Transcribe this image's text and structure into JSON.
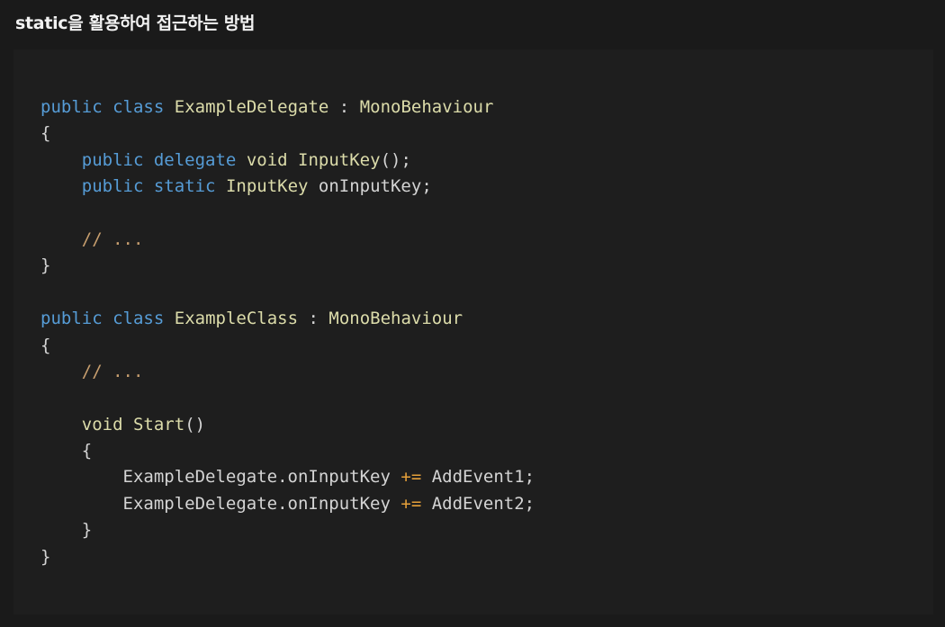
{
  "page": {
    "title": "static을 활용하여 접근하는 방법"
  },
  "code": {
    "lines": [
      [
        {
          "t": "keyword",
          "v": "public"
        },
        {
          "t": "plain",
          "v": " "
        },
        {
          "t": "keyword",
          "v": "class"
        },
        {
          "t": "plain",
          "v": " "
        },
        {
          "t": "type",
          "v": "ExampleDelegate"
        },
        {
          "t": "plain",
          "v": " "
        },
        {
          "t": "punct",
          "v": ":"
        },
        {
          "t": "plain",
          "v": " "
        },
        {
          "t": "type",
          "v": "MonoBehaviour"
        }
      ],
      [
        {
          "t": "punct",
          "v": "{"
        }
      ],
      [
        {
          "t": "plain",
          "v": "    "
        },
        {
          "t": "keyword",
          "v": "public"
        },
        {
          "t": "plain",
          "v": " "
        },
        {
          "t": "keyword",
          "v": "delegate"
        },
        {
          "t": "plain",
          "v": " "
        },
        {
          "t": "type",
          "v": "void"
        },
        {
          "t": "plain",
          "v": " "
        },
        {
          "t": "type",
          "v": "InputKey"
        },
        {
          "t": "paren",
          "v": "()"
        },
        {
          "t": "punct",
          "v": ";"
        }
      ],
      [
        {
          "t": "plain",
          "v": "    "
        },
        {
          "t": "keyword",
          "v": "public"
        },
        {
          "t": "plain",
          "v": " "
        },
        {
          "t": "keyword",
          "v": "static"
        },
        {
          "t": "plain",
          "v": " "
        },
        {
          "t": "type",
          "v": "InputKey"
        },
        {
          "t": "plain",
          "v": " "
        },
        {
          "t": "plain",
          "v": "onInputKey"
        },
        {
          "t": "punct",
          "v": ";"
        }
      ],
      [],
      [
        {
          "t": "plain",
          "v": "    "
        },
        {
          "t": "comment",
          "v": "// ..."
        }
      ],
      [
        {
          "t": "punct",
          "v": "}"
        }
      ],
      [],
      [
        {
          "t": "keyword",
          "v": "public"
        },
        {
          "t": "plain",
          "v": " "
        },
        {
          "t": "keyword",
          "v": "class"
        },
        {
          "t": "plain",
          "v": " "
        },
        {
          "t": "type",
          "v": "ExampleClass"
        },
        {
          "t": "plain",
          "v": " "
        },
        {
          "t": "punct",
          "v": ":"
        },
        {
          "t": "plain",
          "v": " "
        },
        {
          "t": "type",
          "v": "MonoBehaviour"
        }
      ],
      [
        {
          "t": "punct",
          "v": "{"
        }
      ],
      [
        {
          "t": "plain",
          "v": "    "
        },
        {
          "t": "comment",
          "v": "// ..."
        }
      ],
      [],
      [
        {
          "t": "plain",
          "v": "    "
        },
        {
          "t": "type",
          "v": "void"
        },
        {
          "t": "plain",
          "v": " "
        },
        {
          "t": "type",
          "v": "Start"
        },
        {
          "t": "paren",
          "v": "()"
        }
      ],
      [
        {
          "t": "plain",
          "v": "    "
        },
        {
          "t": "punct",
          "v": "{"
        }
      ],
      [
        {
          "t": "plain",
          "v": "        ExampleDelegate.onInputKey "
        },
        {
          "t": "operator",
          "v": "+="
        },
        {
          "t": "plain",
          "v": " AddEvent1"
        },
        {
          "t": "punct",
          "v": ";"
        }
      ],
      [
        {
          "t": "plain",
          "v": "        ExampleDelegate.onInputKey "
        },
        {
          "t": "operator",
          "v": "+="
        },
        {
          "t": "plain",
          "v": " AddEvent2"
        },
        {
          "t": "punct",
          "v": ";"
        }
      ],
      [
        {
          "t": "plain",
          "v": "    "
        },
        {
          "t": "punct",
          "v": "}"
        }
      ],
      [
        {
          "t": "punct",
          "v": "}"
        }
      ]
    ]
  }
}
